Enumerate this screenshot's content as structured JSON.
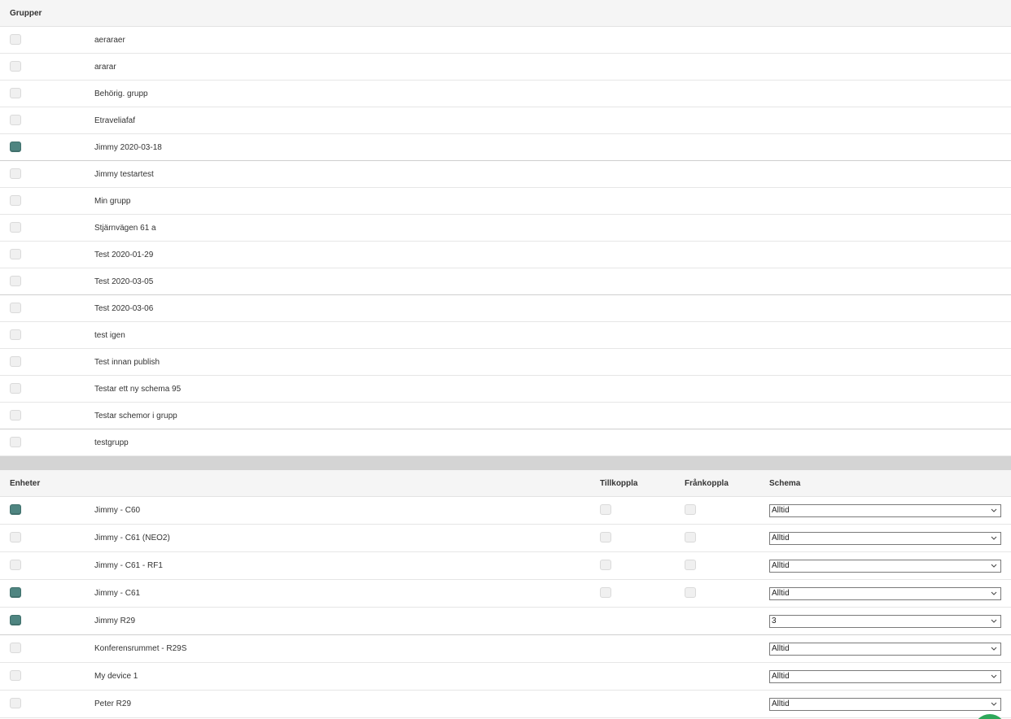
{
  "groups": {
    "header": "Grupper",
    "items": [
      {
        "label": "aeraraer",
        "checked": false
      },
      {
        "label": "ararar",
        "checked": false
      },
      {
        "label": "Behörig. grupp",
        "checked": false
      },
      {
        "label": "Etraveliafaf",
        "checked": false
      },
      {
        "label": "Jimmy 2020-03-18",
        "checked": true
      },
      {
        "label": "Jimmy testartest",
        "checked": false
      },
      {
        "label": "Min grupp",
        "checked": false
      },
      {
        "label": "Stjärnvägen 61 a",
        "checked": false
      },
      {
        "label": "Test 2020-01-29",
        "checked": false
      },
      {
        "label": "Test 2020-03-05",
        "checked": false
      },
      {
        "label": "Test 2020-03-06",
        "checked": false
      },
      {
        "label": "test igen",
        "checked": false
      },
      {
        "label": "Test innan publish",
        "checked": false
      },
      {
        "label": "Testar ett ny schema 95",
        "checked": false
      },
      {
        "label": "Testar schemor i grupp",
        "checked": false
      },
      {
        "label": "testgrupp",
        "checked": false
      }
    ]
  },
  "devices": {
    "header": "Enheter",
    "col_tillkoppla": "Tillkoppla",
    "col_frankoppla": "Frånkoppla",
    "col_schema": "Schema",
    "items": [
      {
        "label": "Jimmy - C60",
        "checked": true,
        "has_toggles": true,
        "schema": "Alltid"
      },
      {
        "label": "Jimmy - C61 (NEO2)",
        "checked": false,
        "has_toggles": true,
        "schema": "Alltid"
      },
      {
        "label": "Jimmy - C61 - RF1",
        "checked": false,
        "has_toggles": true,
        "schema": "Alltid"
      },
      {
        "label": "Jimmy - C61",
        "checked": true,
        "has_toggles": true,
        "schema": "Alltid"
      },
      {
        "label": "Jimmy R29",
        "checked": true,
        "has_toggles": false,
        "schema": "3"
      },
      {
        "label": "Konferensrummet - R29S",
        "checked": false,
        "has_toggles": false,
        "schema": "Alltid"
      },
      {
        "label": "My device 1",
        "checked": false,
        "has_toggles": false,
        "schema": "Alltid"
      },
      {
        "label": "Peter R29",
        "checked": false,
        "has_toggles": false,
        "schema": "Alltid"
      }
    ]
  },
  "colors": {
    "checked": "#4f8581",
    "header_bg": "#f5f5f5",
    "divider_band": "#d4d4d4",
    "fab": "#2ea85a"
  },
  "icons": {
    "select": "chevron-down-icon",
    "fab": "help-chat-icon"
  }
}
